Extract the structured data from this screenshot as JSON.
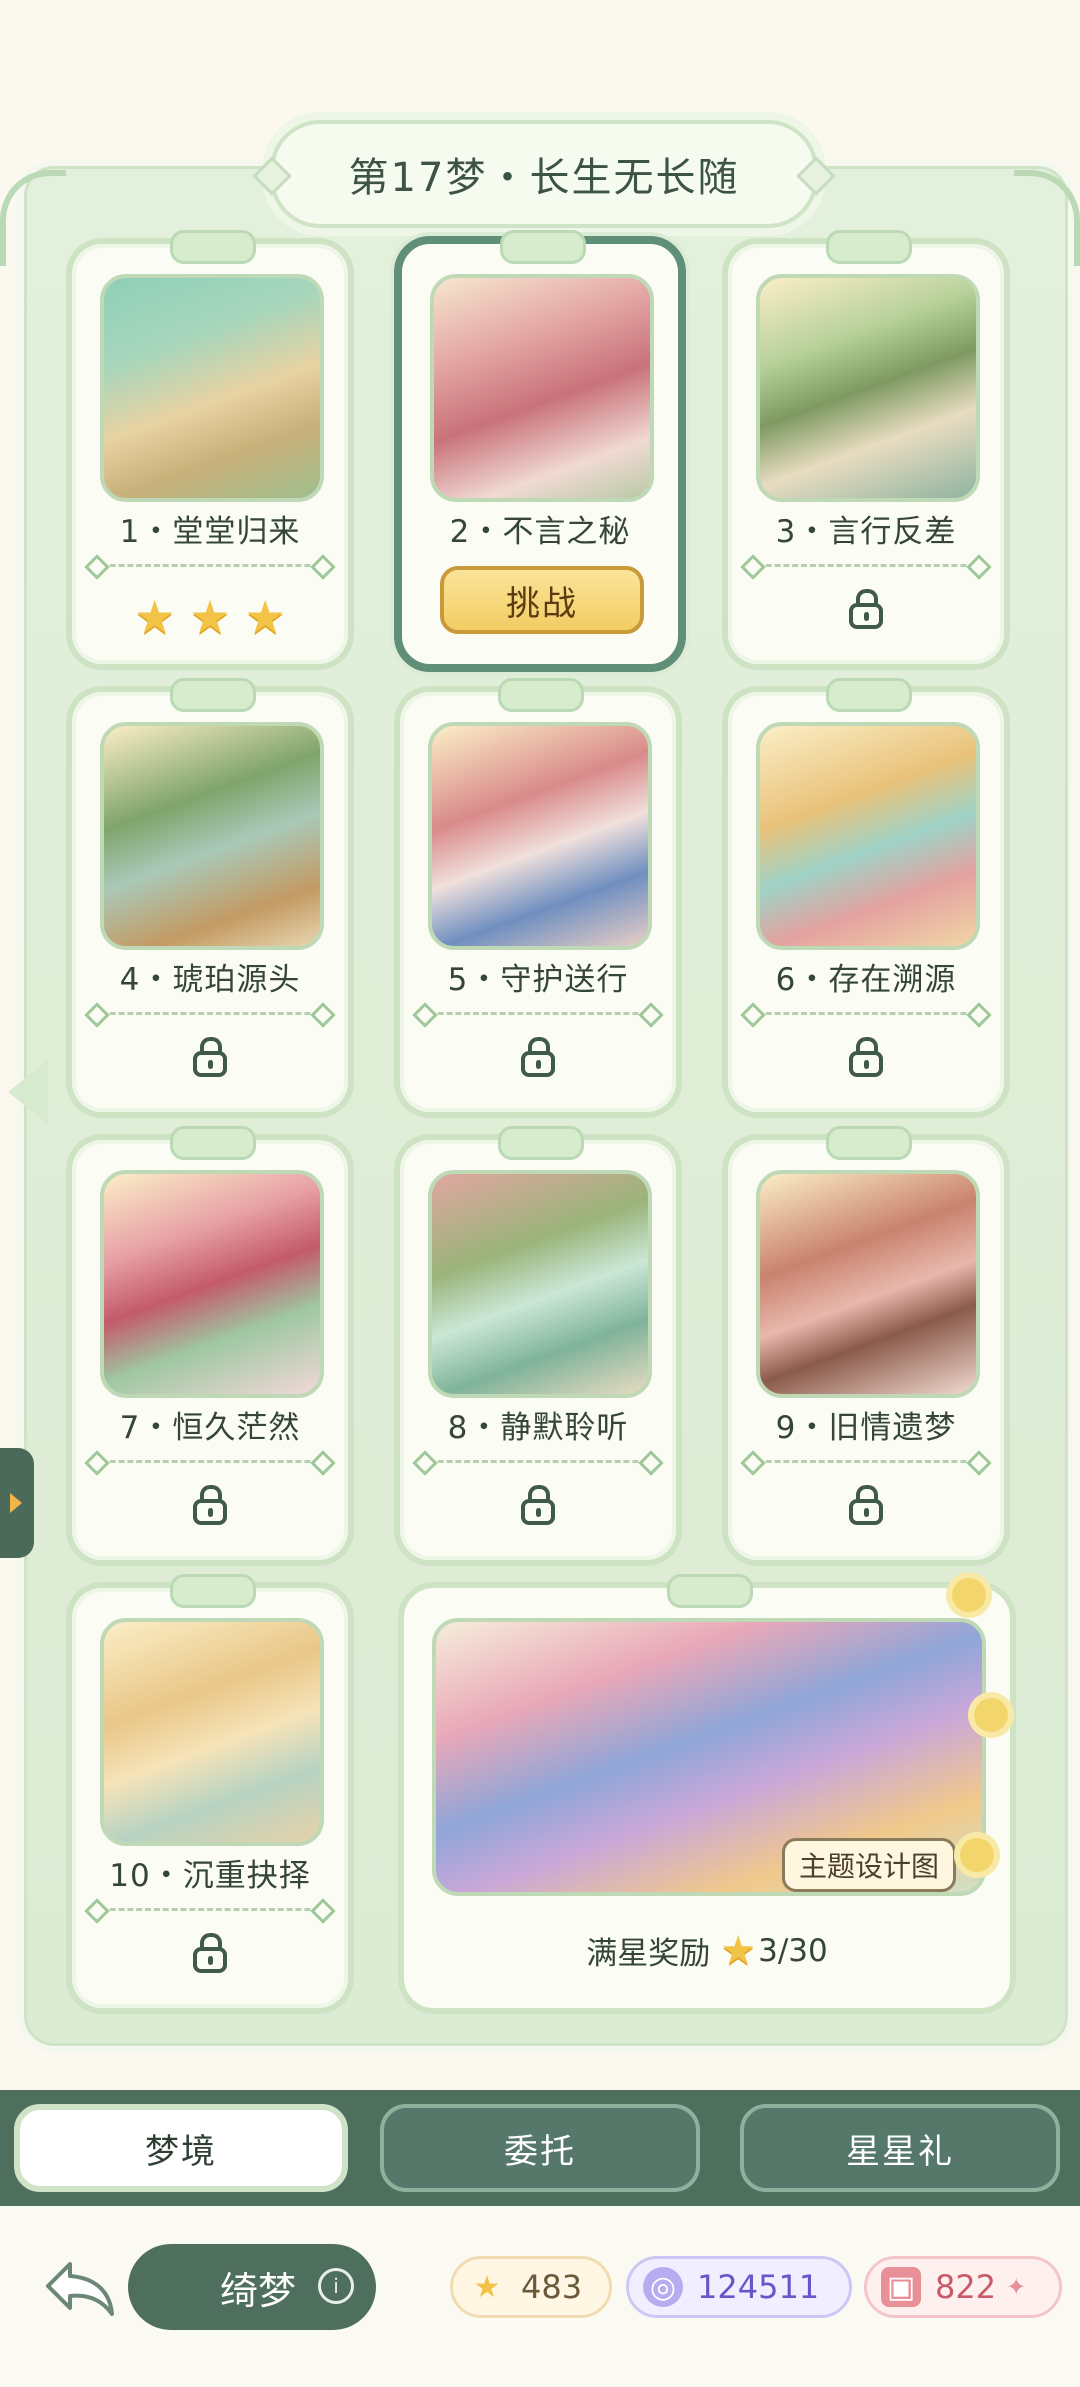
{
  "title": "第17梦・长生无长随",
  "levels": [
    {
      "label": "1・堂堂归来",
      "state": "cleared",
      "stars": 3
    },
    {
      "label": "2・不言之秘",
      "state": "current",
      "button": "挑战"
    },
    {
      "label": "3・言行反差",
      "state": "locked"
    },
    {
      "label": "4・琥珀源头",
      "state": "locked"
    },
    {
      "label": "5・守护送行",
      "state": "locked"
    },
    {
      "label": "6・存在溯源",
      "state": "locked"
    },
    {
      "label": "7・恒久茫然",
      "state": "locked"
    },
    {
      "label": "8・静默聆听",
      "state": "locked"
    },
    {
      "label": "9・旧情遗梦",
      "state": "locked"
    },
    {
      "label": "10・沉重抉择",
      "state": "locked"
    }
  ],
  "reward": {
    "tag": "主题设计图",
    "label": "满星奖励",
    "progress": "3/30"
  },
  "tabs": [
    {
      "label": "梦境",
      "active": true
    },
    {
      "label": "委托",
      "active": false
    },
    {
      "label": "星星礼",
      "active": false
    }
  ],
  "footer": {
    "chapter_name": "绮梦",
    "stars": "483",
    "gems": "124511",
    "cards": "822"
  },
  "colors": {
    "accent": "#4e6f5d",
    "star": "#f2c346",
    "button": "#f2cd63"
  }
}
